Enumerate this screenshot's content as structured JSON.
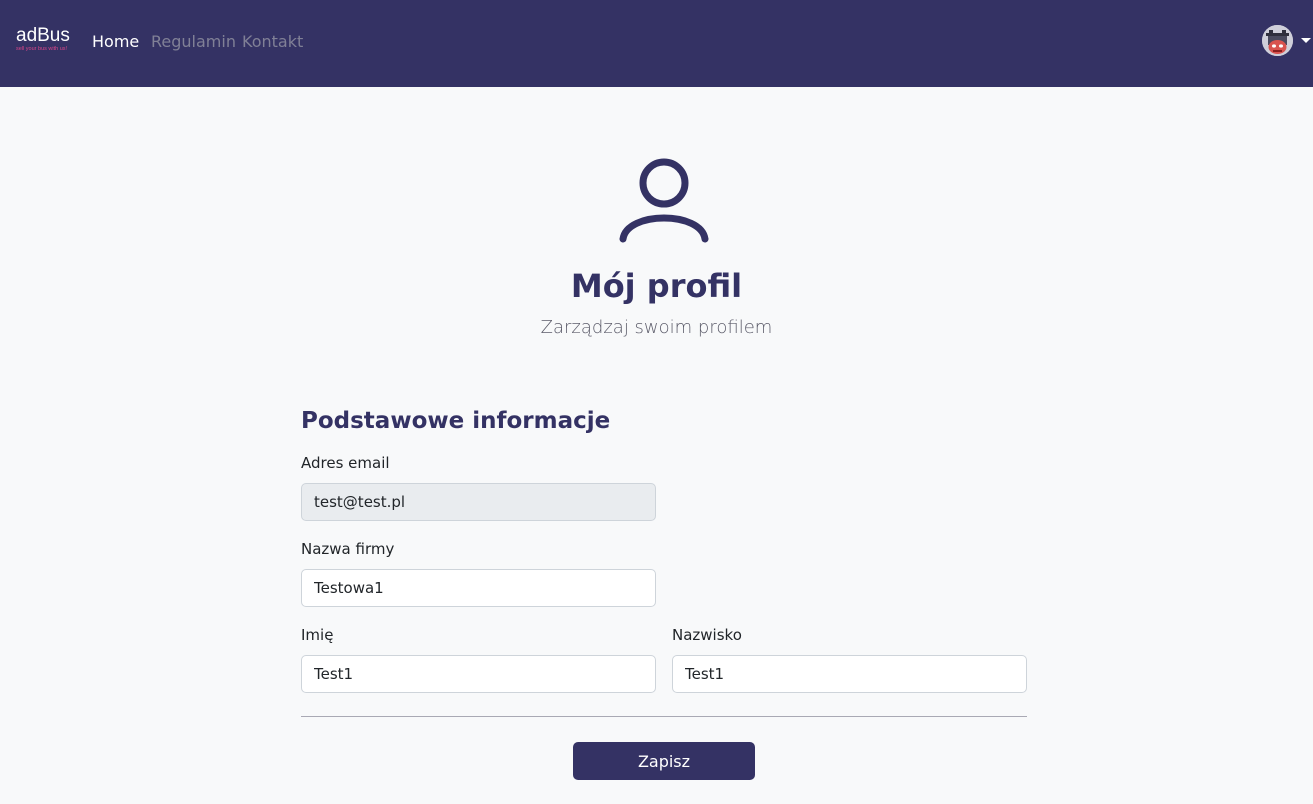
{
  "navbar": {
    "brand_name": "adBus",
    "brand_tagline": "sell your bus with us!",
    "links": [
      {
        "label": "Home",
        "active": true
      },
      {
        "label": "Regulamin",
        "active": false
      },
      {
        "label": "Kontakt",
        "active": false
      }
    ],
    "user_menu_icon": "avatar-icon"
  },
  "hero": {
    "icon": "user-profile-icon",
    "title": "Mój profil",
    "subtitle": "Zarządzaj swoim profilem"
  },
  "form": {
    "section_title": "Podstawowe informacje",
    "email": {
      "label": "Adres email",
      "value": "test@test.pl",
      "readonly": true
    },
    "company": {
      "label": "Nazwa firmy",
      "value": "Testowa1"
    },
    "first_name": {
      "label": "Imię",
      "value": "Test1"
    },
    "last_name": {
      "label": "Nazwisko",
      "value": "Test1"
    },
    "submit_label": "Zapisz"
  },
  "colors": {
    "brand_primary": "#343264",
    "page_background": "#f8f9fa",
    "readonly_field": "#e9ecef",
    "tagline_accent": "#d9468a"
  }
}
